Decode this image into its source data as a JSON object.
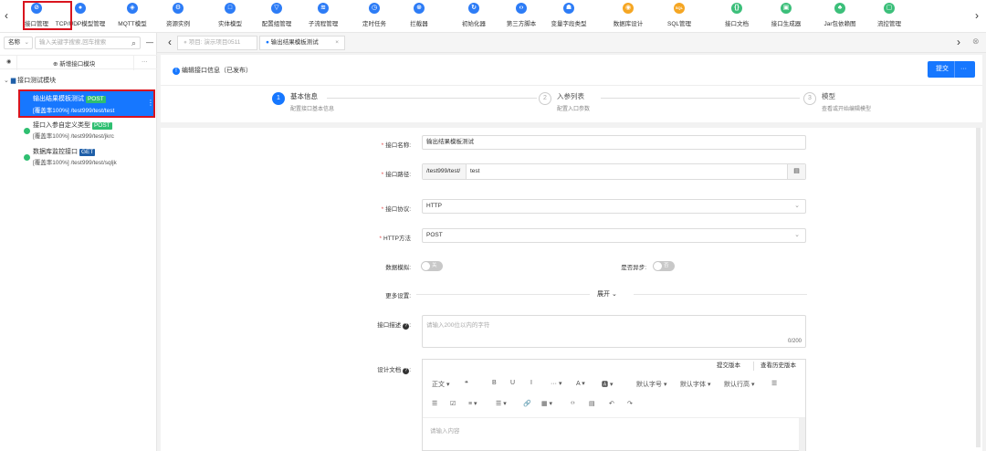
{
  "colors": {
    "primary": "#1677ff",
    "post": "#2fbf71",
    "get": "#1f5fa8",
    "highlight": "#d9141e"
  },
  "nav": {
    "prev_icon": "‹",
    "next_icon": "›",
    "items": [
      {
        "label": "接口管理",
        "icon": "link-icon",
        "color": "#2d7cf6",
        "glyph": "⊘"
      },
      {
        "label": "TCP/UDP模型管理",
        "icon": "tcp-icon",
        "color": "#2d7cf6",
        "glyph": "●"
      },
      {
        "label": "MQTT模型",
        "icon": "mqtt-icon",
        "color": "#2d7cf6",
        "glyph": "◈"
      },
      {
        "label": "资源实例",
        "icon": "resource-icon",
        "color": "#2d7cf6",
        "glyph": "⚙"
      },
      {
        "label": "实体模型",
        "icon": "entity-icon",
        "color": "#2d7cf6",
        "glyph": "□"
      },
      {
        "label": "配置组管理",
        "icon": "config-icon",
        "color": "#2d7cf6",
        "glyph": "▽"
      },
      {
        "label": "子流程管理",
        "icon": "subflow-icon",
        "color": "#2d7cf6",
        "glyph": "≋"
      },
      {
        "label": "定时任务",
        "icon": "clock-icon",
        "color": "#2d7cf6",
        "glyph": "◷"
      },
      {
        "label": "拦截器",
        "icon": "interceptor-icon",
        "color": "#2d7cf6",
        "glyph": "⊗"
      },
      {
        "label": "初始化器",
        "icon": "init-icon",
        "color": "#2d7cf6",
        "glyph": "↻"
      },
      {
        "label": "第三方脚本",
        "icon": "script-icon",
        "color": "#2d7cf6",
        "glyph": "‹›"
      },
      {
        "label": "变量字段类型",
        "icon": "variable-icon",
        "color": "#2d7cf6",
        "glyph": "☗"
      },
      {
        "label": "数据库设计",
        "icon": "database-icon",
        "color": "#f5a623",
        "glyph": "◉"
      },
      {
        "label": "SQL管理",
        "icon": "sql-icon",
        "color": "#f5a623",
        "glyph": "SQL"
      },
      {
        "label": "接口文档",
        "icon": "doc-icon",
        "color": "#3cbf7a",
        "glyph": "{}"
      },
      {
        "label": "接口生成器",
        "icon": "generator-icon",
        "color": "#3cbf7a",
        "glyph": "▣"
      },
      {
        "label": "Jar包依赖图",
        "icon": "jar-icon",
        "color": "#3cbf7a",
        "glyph": "♣"
      },
      {
        "label": "流控管理",
        "icon": "flow-control-icon",
        "color": "#3cbf7a",
        "glyph": "▢"
      }
    ]
  },
  "sidebar": {
    "search_type": "名称",
    "search_type_arrow": "⌄",
    "search_placeholder": "输入关键字搜索,回车搜索",
    "search_icon": "⌕",
    "collapse_icon": "—",
    "eye_icon": "◉",
    "add_module_label": "新增接口模块",
    "add_icon": "⊕",
    "more_icon": "···",
    "module_name": "接口测试模块",
    "module_arrow": "⌄",
    "folder_icon": "▆",
    "items": [
      {
        "name": "输出结果模板测试",
        "method": "POST",
        "coverage": "[覆盖率100%]",
        "path": "/test999/test/test"
      },
      {
        "name": "接口入参自定义类型",
        "method": "POST",
        "coverage": "[覆盖率100%]",
        "path": "/test999/test/jkrc"
      },
      {
        "name": "数据库监控接口",
        "method": "GET",
        "coverage": "[覆盖率100%]",
        "path": "/test999/test/sqljk"
      }
    ],
    "kebab_icon": "⋮"
  },
  "tabs": {
    "prev": "‹",
    "next": "›",
    "close_all": "⊗",
    "items": [
      {
        "label": "项目: 演示项目0511"
      },
      {
        "label": "输出结果模板测试",
        "close": "×"
      }
    ]
  },
  "editor": {
    "status_text": "编辑接口信息（已发布）",
    "submit_label": "提交",
    "submit_more": "···",
    "steps": [
      {
        "num": "1",
        "title": "基本信息",
        "desc": "配置接口基本信息"
      },
      {
        "num": "2",
        "title": "入参列表",
        "desc": "配置入口参数"
      },
      {
        "num": "3",
        "title": "模型",
        "desc": "查看或开始编辑模型"
      }
    ],
    "form": {
      "name_label": "接口名称:",
      "name_value": "输出结果模板测试",
      "path_label": "接口路径:",
      "path_prefix": "/test999/test/",
      "path_value": "test",
      "copy_icon": "▤",
      "protocol_label": "接口协议:",
      "protocol_value": "HTTP",
      "method_label": "HTTP方法",
      "method_value": "POST",
      "mock_label": "数据模拟:",
      "mock_value": "关",
      "async_label": "是否异步:",
      "async_value": "否",
      "more_label": "更多设置:",
      "expand_label": "展开 ⌄",
      "desc_label": "接口描述",
      "desc_placeholder": "请输入200位以内的字符",
      "desc_count": "0/200",
      "design_label": "设计文档",
      "submit_version": "提交版本",
      "view_history": "查看历史版本",
      "toolbar_row1": [
        "正文 ▾",
        "❝",
        "B",
        "U",
        "I",
        "··· ▾",
        "A ▾",
        "🅰 ▾",
        "默认字号 ▾",
        "默认字体 ▾",
        "默认行高 ▾",
        "☰"
      ],
      "toolbar_row2": [
        "☰",
        "☑",
        "≡ ▾",
        "☰ ▾",
        "🔗",
        "▦ ▾",
        "‹›",
        "▤",
        "↶",
        "↷"
      ],
      "content_placeholder": "请输入内容"
    }
  }
}
